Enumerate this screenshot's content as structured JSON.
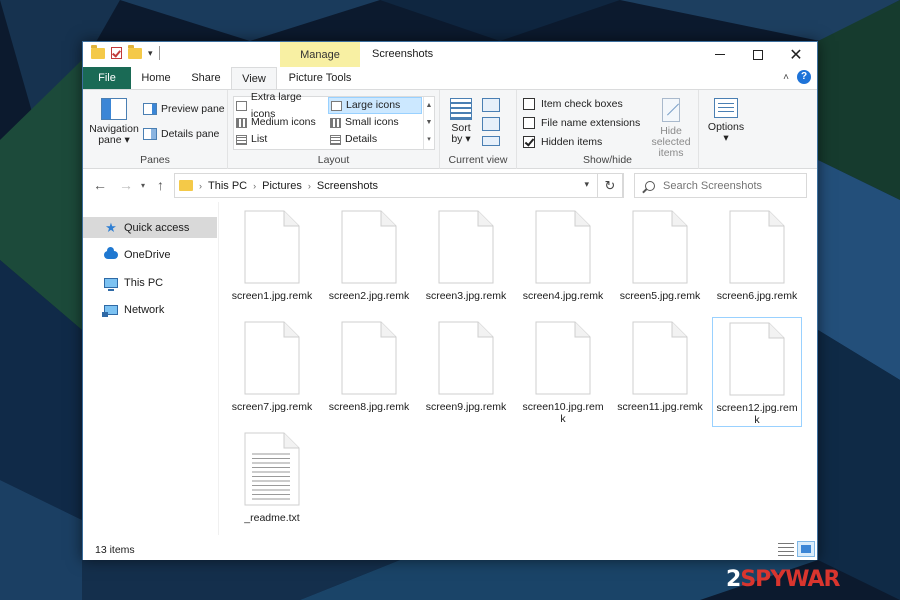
{
  "window": {
    "title": "Screenshots",
    "manage_label": "Manage",
    "tabs": [
      "File",
      "Home",
      "Share",
      "View",
      "Picture Tools"
    ]
  },
  "ribbon": {
    "panes": {
      "navigation_pane": "Navigation pane",
      "preview_pane": "Preview pane",
      "details_pane": "Details pane",
      "group_label": "Panes"
    },
    "layout": {
      "items": [
        "Extra large icons",
        "Large icons",
        "Medium icons",
        "Small icons",
        "List",
        "Details"
      ],
      "selected": "Large icons",
      "group_label": "Layout"
    },
    "current_view": {
      "sort_label": "Sort by",
      "group_label": "Current view"
    },
    "show_hide": {
      "item_check_boxes": "Item check boxes",
      "file_name_extensions": "File name extensions",
      "hidden_items": "Hidden items",
      "hide_selected": "Hide selected items",
      "group_label": "Show/hide"
    },
    "options_label": "Options"
  },
  "address": {
    "path": [
      "This PC",
      "Pictures",
      "Screenshots"
    ],
    "search_placeholder": "Search Screenshots"
  },
  "sidebar": {
    "items": [
      "Quick access",
      "OneDrive",
      "This PC",
      "Network"
    ]
  },
  "files": [
    "screen1.jpg.remk",
    "screen2.jpg.remk",
    "screen3.jpg.remk",
    "screen4.jpg.remk",
    "screen5.jpg.remk",
    "screen6.jpg.remk",
    "screen7.jpg.remk",
    "screen8.jpg.remk",
    "screen9.jpg.remk",
    "screen10.jpg.remk",
    "screen11.jpg.remk",
    "screen12.jpg.remk",
    "_readme.txt"
  ],
  "status": {
    "item_count": "13 items"
  },
  "watermark": {
    "prefix": "2",
    "brand": "SPYWAR"
  }
}
